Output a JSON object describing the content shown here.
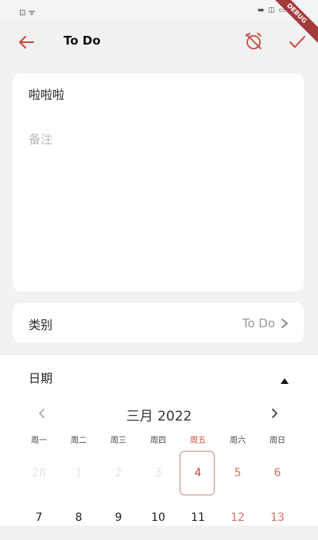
{
  "status_bar": {
    "left": "⊡ ᯤ",
    "right": "▬ ◫ ▭"
  },
  "debug_ribbon": "DEBUG",
  "app_bar": {
    "title": "To Do"
  },
  "todo": {
    "title": "啦啦啦",
    "note_placeholder": "备注"
  },
  "category": {
    "label": "类别",
    "value": "To Do"
  },
  "date": {
    "label": "日期"
  },
  "calendar": {
    "month_title": "三月 2022",
    "weekdays": [
      "周一",
      "周二",
      "周三",
      "周四",
      "周五",
      "周六",
      "周日"
    ],
    "highlight_weekday_index": 4,
    "weeks": [
      [
        {
          "d": "28",
          "type": "out"
        },
        {
          "d": "1",
          "type": "out"
        },
        {
          "d": "2",
          "type": "out"
        },
        {
          "d": "3",
          "type": "out"
        },
        {
          "d": "4",
          "type": "today"
        },
        {
          "d": "5",
          "type": "weekend"
        },
        {
          "d": "6",
          "type": "weekend"
        }
      ],
      [
        {
          "d": "7",
          "type": "normal"
        },
        {
          "d": "8",
          "type": "normal"
        },
        {
          "d": "9",
          "type": "normal"
        },
        {
          "d": "10",
          "type": "normal"
        },
        {
          "d": "11",
          "type": "normal"
        },
        {
          "d": "12",
          "type": "weekend"
        },
        {
          "d": "13",
          "type": "weekend"
        }
      ]
    ]
  },
  "colors": {
    "accent": "#c94a3e",
    "background": "#f1f1f1",
    "card": "#ffffff"
  }
}
